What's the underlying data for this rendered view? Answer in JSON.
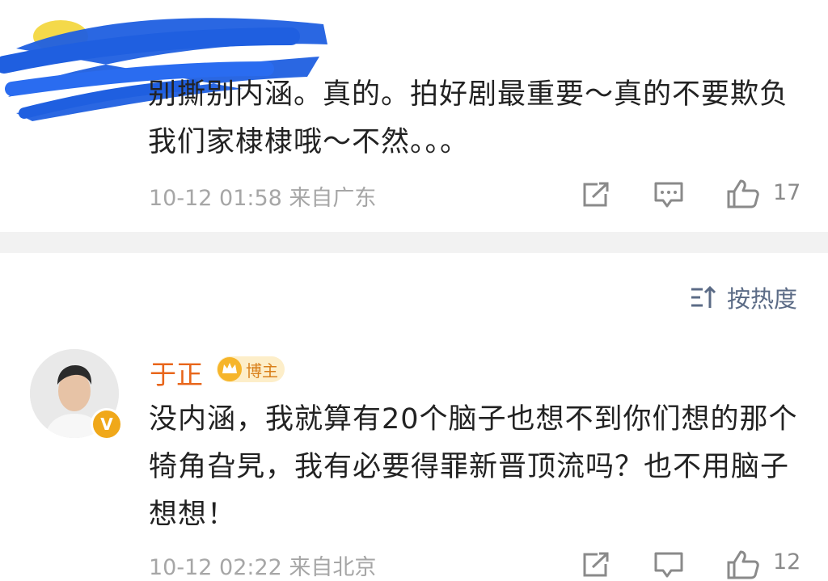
{
  "comment1": {
    "text": "别撕别内涵。真的。拍好剧最重要～真的不要欺负我们家棣棣哦～不然。。。",
    "meta": "10-12 01:58 来自广东",
    "likes": "17"
  },
  "sort": {
    "label": "按热度"
  },
  "comment2": {
    "username": "于正",
    "badge": "博主",
    "avatar_badge": "V",
    "text": "没内涵，我就算有20个脑子也想不到你们想的那个犄角旮旯，我有必要得罪新晋顶流吗？也不用脑子想想！",
    "meta": "10-12 02:22 来自北京",
    "likes": "12"
  },
  "colors": {
    "username": "#e8651a",
    "sort_text": "#5b6b86",
    "meta_text": "#a6a6a6",
    "redaction": "#1f5fe0"
  }
}
